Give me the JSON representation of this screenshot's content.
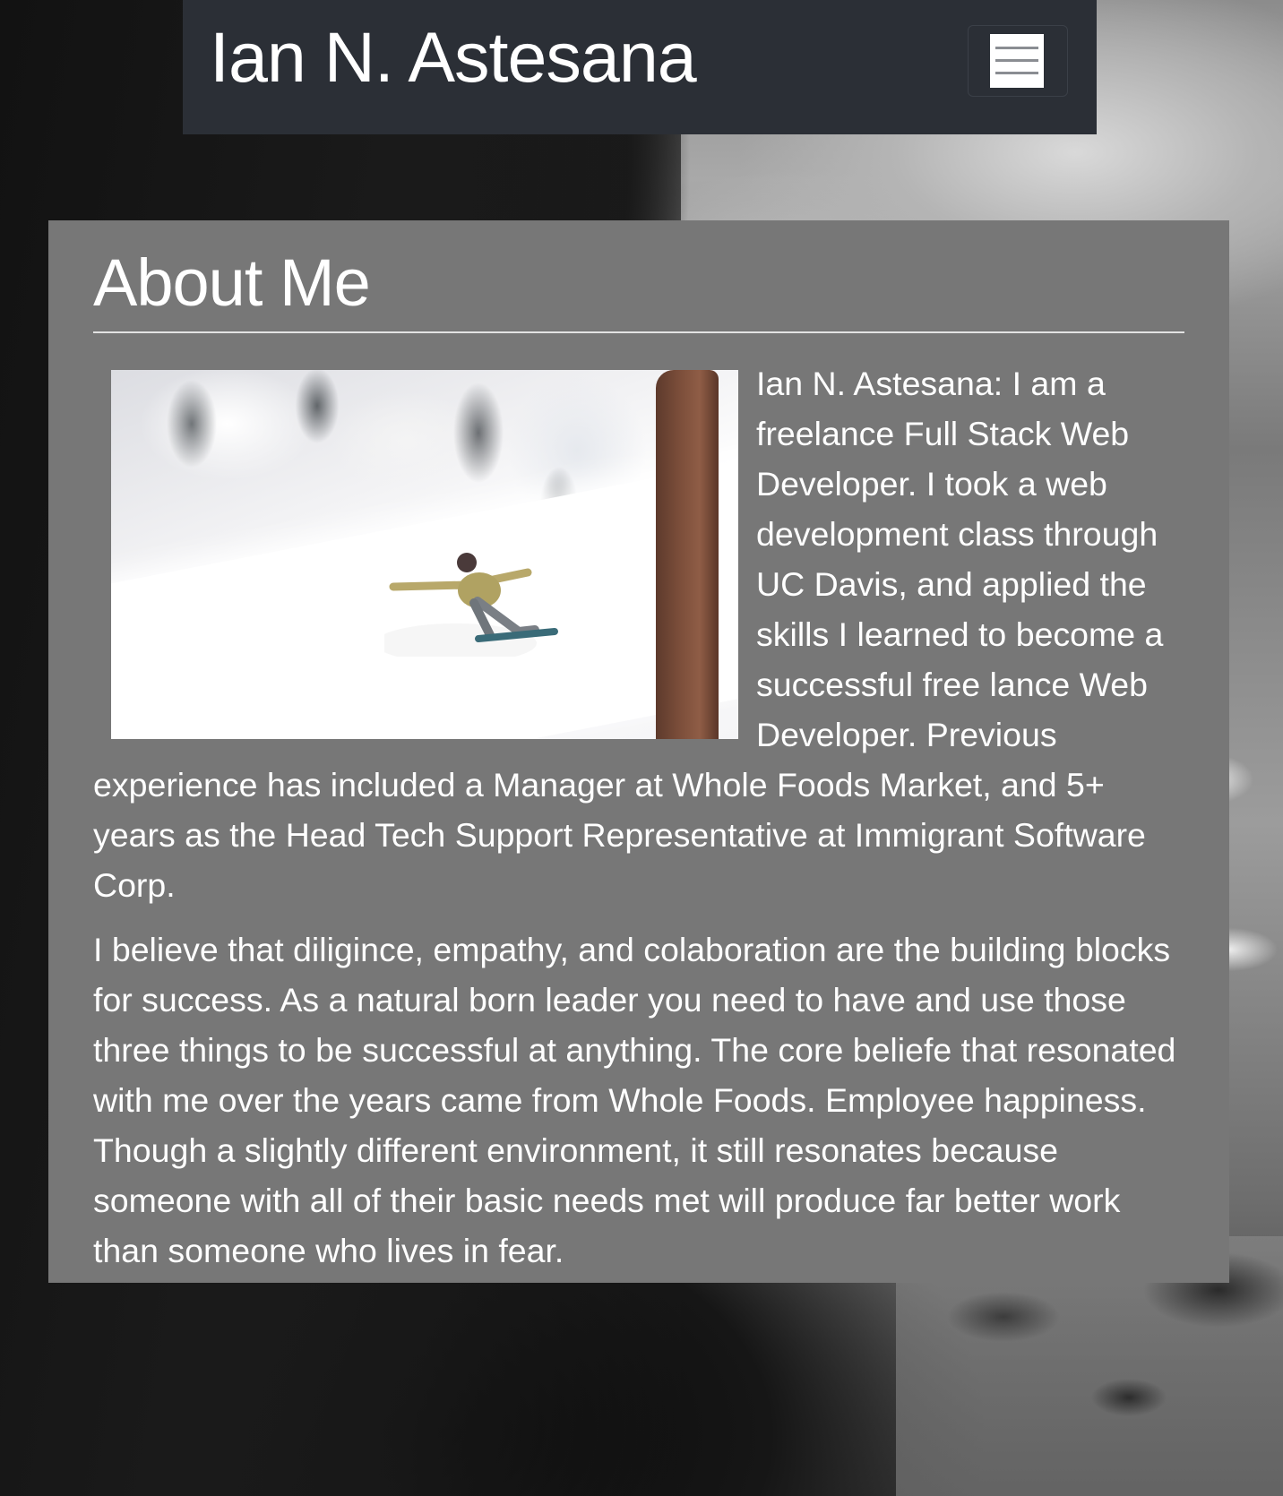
{
  "navbar": {
    "brand": "Ian N. Astesana",
    "toggle_icon": "hamburger-menu-icon"
  },
  "about": {
    "title": "About Me",
    "photo": "snowboarder-photo",
    "paragraphs": [
      "Ian N. Astesana: I am a freelance Full Stack Web Developer. I took a web development class through UC Davis, and applied the skills I learned to become a successful free lance Web Developer. Previous experience has included a Manager at Whole Foods Market, and 5+ years as the Head Tech Support Representative at Immigrant Software Corp.",
      "I believe that diligince, empathy, and colaboration are the building blocks for success. As a natural born leader you need to have and use those three things to be successful at anything. The core beliefe that resonated with me over the years came from Whole Foods. Employee happiness. Though a slightly different environment, it still resonates because someone with all of their basic needs met will produce far better work than someone who lives in fear."
    ]
  },
  "colors": {
    "navbar_bg": "#2b2f36",
    "card_bg": "#777777",
    "text": "#ffffff"
  }
}
